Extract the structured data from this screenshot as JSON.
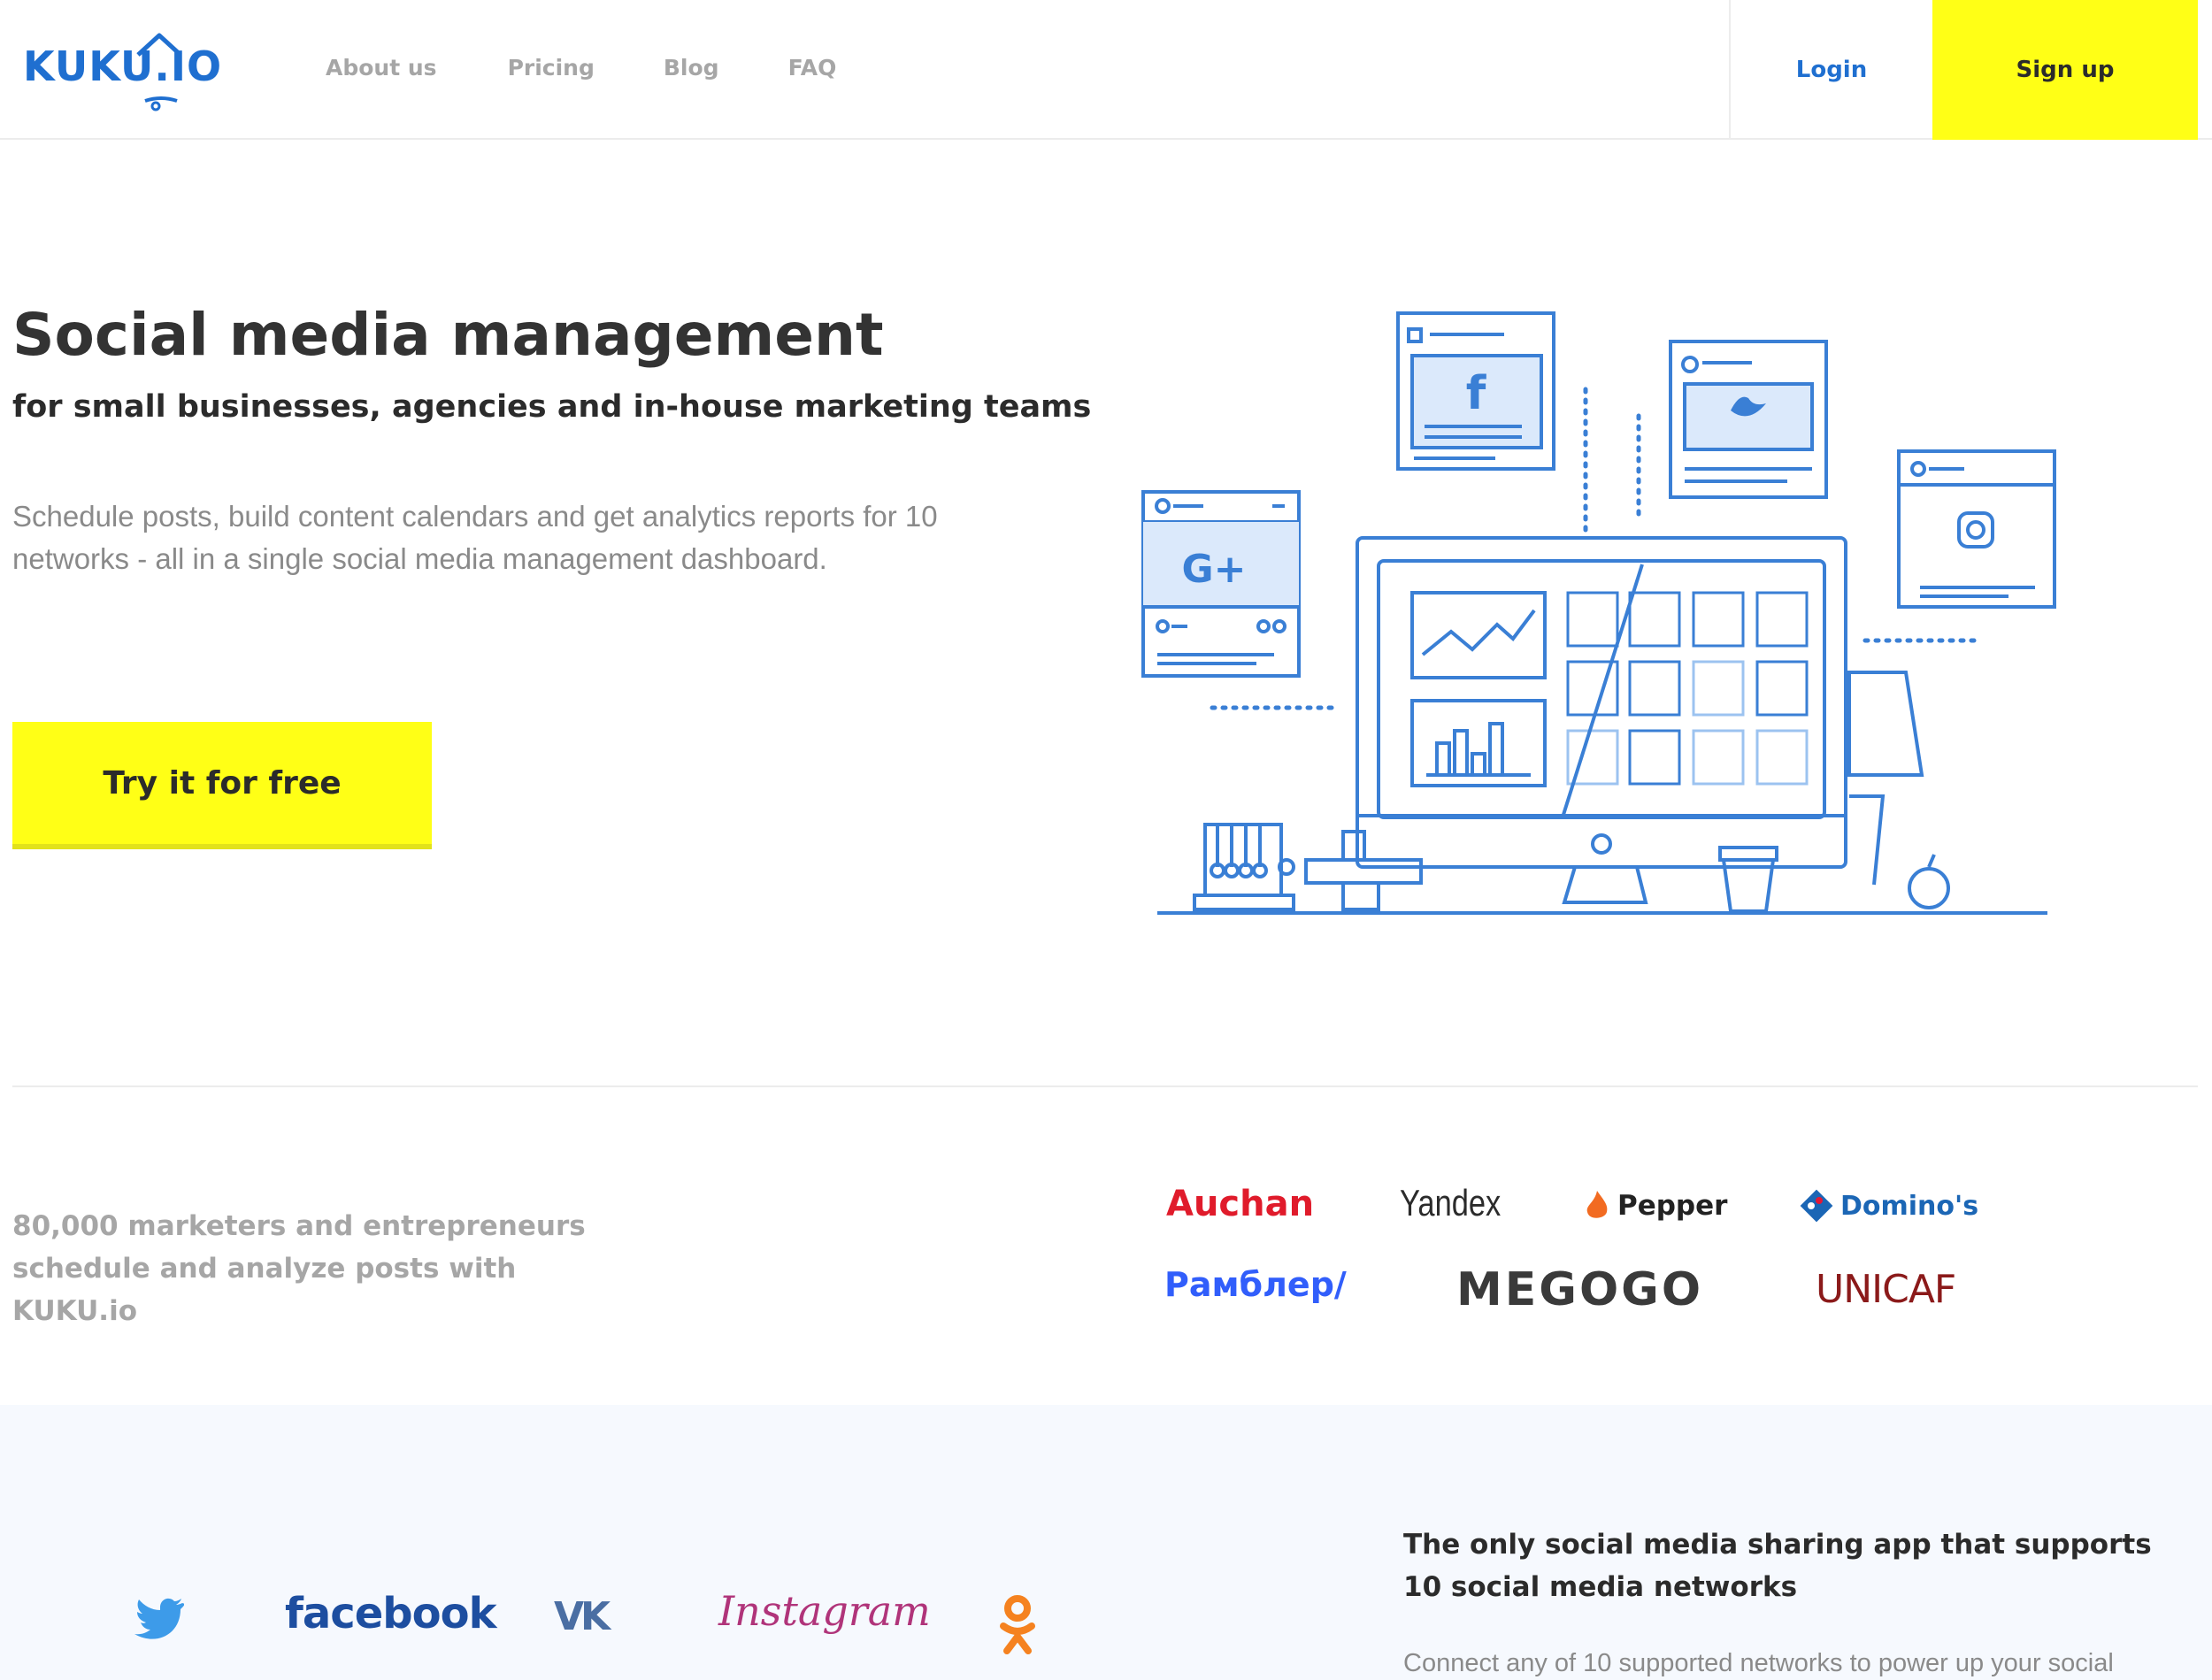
{
  "header": {
    "logo_text": "KUKU.IO",
    "nav": [
      "About us",
      "Pricing",
      "Blog",
      "FAQ"
    ],
    "login_label": "Login",
    "signup_label": "Sign up",
    "accent_color": "#ffff16",
    "brand_color": "#1f6fd0"
  },
  "hero": {
    "title": "Social media management",
    "subtitle": "for small businesses, agencies and in-house marketing teams",
    "description": "Schedule posts, build content calendars and get analytics reports for 10 networks - all in a single social media management dashboard.",
    "cta_label": "Try it for free",
    "illustration_cards": [
      "f",
      "G+"
    ]
  },
  "clients": {
    "text": "80,000 marketers and entrepreneurs schedule and analyze posts with KUKU.io",
    "logos": [
      "Auchan",
      "Yandex",
      "Pepper",
      "Domino's",
      "Рамблер/",
      "MEGOGO",
      "UNICAF"
    ]
  },
  "networks": {
    "logos": [
      "twitter-icon",
      "facebook",
      "vk-icon",
      "Instagram",
      "odnoklassniki-icon"
    ],
    "facebook_text": "facebook",
    "vk_text": "VK",
    "instagram_text": "Instagram",
    "title": "The only social media sharing app that supports 10 social media networks",
    "description": "Connect any of 10 supported networks to power up your social"
  }
}
